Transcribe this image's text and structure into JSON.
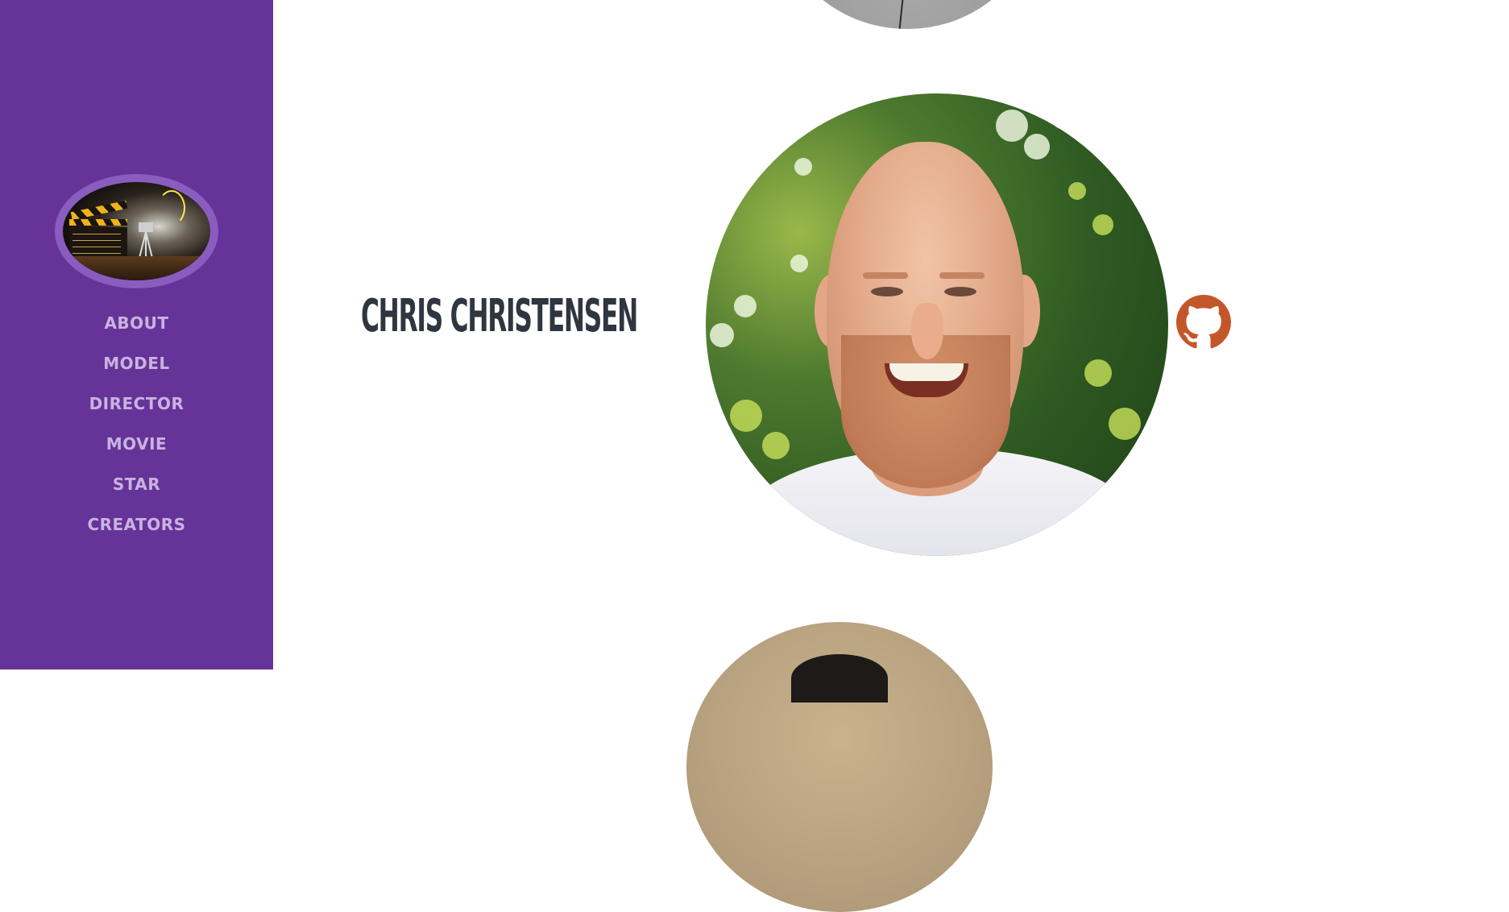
{
  "sidebar": {
    "logo_icon": "clapperboard-film-set-logo",
    "background_color": "#663399",
    "menu_color": "#c8b3e0",
    "items": [
      {
        "label": "ABOUT"
      },
      {
        "label": "MODEL"
      },
      {
        "label": "DIRECTOR"
      },
      {
        "label": "MOVIE"
      },
      {
        "label": "STAR"
      },
      {
        "label": "CREATORS"
      }
    ]
  },
  "creators": {
    "current": {
      "name": "CHRIS CHRISTENSEN",
      "name_color": "#2f3640",
      "avatar_icon": "portrait-photo",
      "link_icon": "github-icon",
      "link_color": "#c4572a"
    }
  }
}
